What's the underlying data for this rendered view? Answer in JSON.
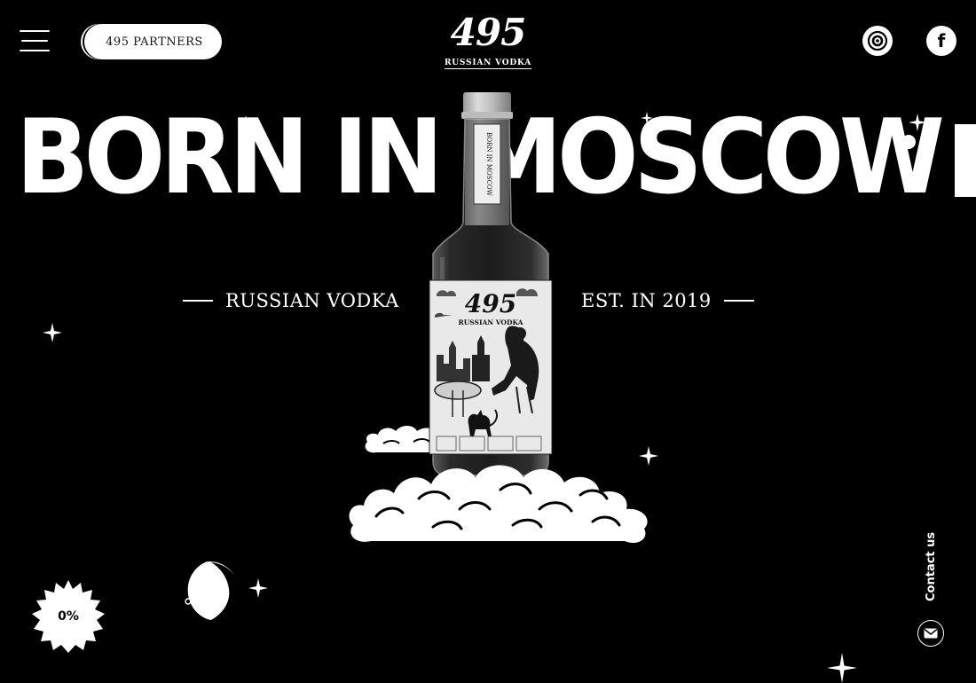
{
  "header": {
    "partners_label": "495 PARTNERS",
    "logo_number": "495",
    "logo_subtitle": "RUSSIAN VODKA",
    "menu_icon": "hamburger-menu-icon",
    "social": [
      {
        "name": "instagram",
        "icon": "instagram-icon"
      },
      {
        "name": "facebook",
        "icon": "facebook-icon",
        "glyph": "f"
      }
    ]
  },
  "hero": {
    "headline": "BORN IN MOSCOW",
    "left_label": "RUSSIAN VODKA",
    "right_label": "EST. IN 2019"
  },
  "bottle_label": {
    "brand_number": "495",
    "brand_subtitle": "RUSSIAN VODKA",
    "neck_text": "BORN IN MOSCOW"
  },
  "loader": {
    "percent": "0%",
    "progress": 0
  },
  "contact": {
    "label": "Contact us",
    "icon": "envelope-icon"
  },
  "colors": {
    "background": "#000000",
    "foreground": "#ffffff"
  }
}
